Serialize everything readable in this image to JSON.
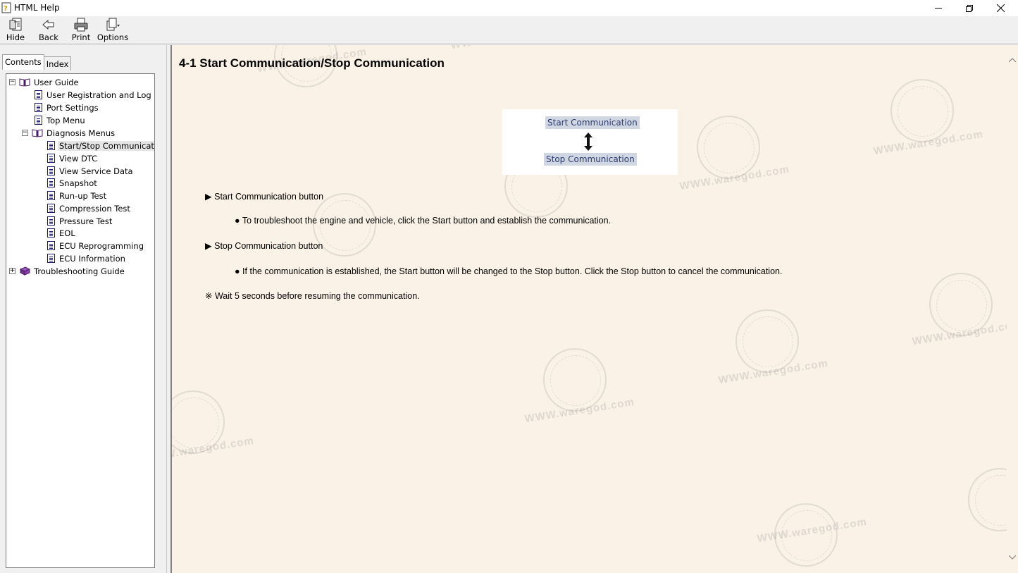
{
  "window": {
    "title": "HTML Help"
  },
  "toolbar": {
    "hide": "Hide",
    "back": "Back",
    "print": "Print",
    "options": "Options"
  },
  "tabs": {
    "contents": "Contents",
    "index": "Index"
  },
  "tree": {
    "user_guide": "User Guide",
    "user_registration": "User Registration and Log In",
    "port_settings": "Port Settings",
    "top_menu": "Top Menu",
    "diagnosis_menus": "Diagnosis Menus",
    "start_stop": "Start/Stop Communication",
    "view_dtc": "View DTC",
    "view_service_data": "View Service Data",
    "snapshot": "Snapshot",
    "run_up_test": "Run-up Test",
    "compression_test": "Compression Test",
    "pressure_test": "Pressure Test",
    "eol": "EOL",
    "ecu_reprogramming": "ECU Reprogramming",
    "ecu_information": "ECU Information",
    "troubleshooting_guide": "Troubleshooting Guide"
  },
  "content": {
    "title": "4-1 Start Communication/Stop Communication",
    "diagram": {
      "start_label": "Start Communication",
      "stop_label": "Stop Communication"
    },
    "start_heading": "Start Communication button",
    "start_bullet": "To troubleshoot the engine and vehicle, click the Start button and establish the communication.",
    "stop_heading": "Stop Communication button",
    "stop_bullet": "If the communication is established, the Start button will be changed to the Stop button. Click the Stop button to cancel the communication.",
    "note": "Wait 5 seconds before resuming the communication."
  },
  "watermark": {
    "text": "WWW.waregod.com"
  },
  "colors": {
    "content_bg": "#faf2e6",
    "diagram_button_bg": "#d0d6e2",
    "diagram_button_text": "#2b3a6e"
  }
}
